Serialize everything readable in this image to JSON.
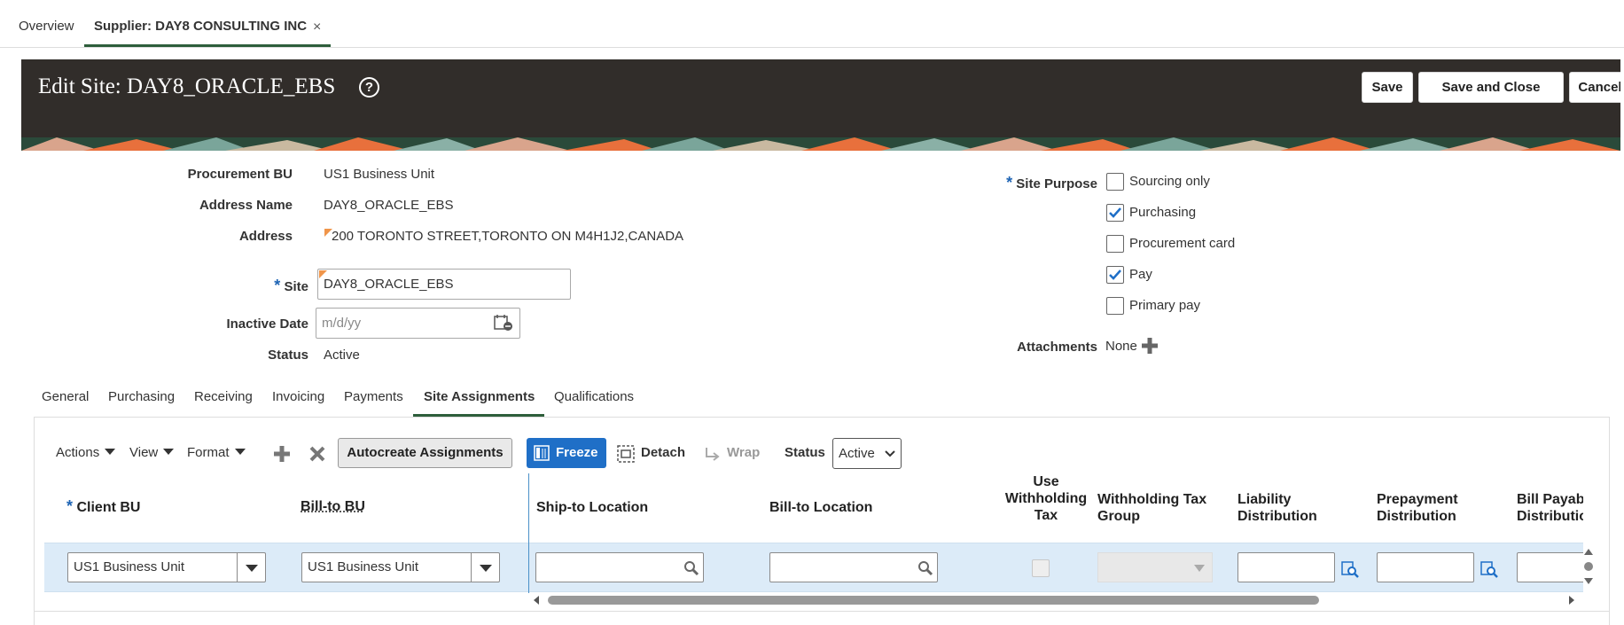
{
  "topnav": {
    "overview": "Overview",
    "supplier_tab": "Supplier: DAY8 CONSULTING INC",
    "close_glyph": "×"
  },
  "header": {
    "title": "Edit Site: DAY8_ORACLE_EBS",
    "help_glyph": "?",
    "save": "Save",
    "save_close": "Save and Close",
    "cancel": "Cancel"
  },
  "form": {
    "procurement_bu_label": "Procurement BU",
    "procurement_bu": "US1 Business Unit",
    "address_name_label": "Address Name",
    "address_name": "DAY8_ORACLE_EBS",
    "address_label": "Address",
    "address": "200 TORONTO STREET,TORONTO ON M4H1J2,CANADA",
    "site_label": "Site",
    "site": "DAY8_ORACLE_EBS",
    "inactive_date_label": "Inactive Date",
    "inactive_date_placeholder": "m/d/yy",
    "status_label": "Status",
    "status": "Active",
    "required_mark": "*"
  },
  "site_purpose": {
    "label": "Site Purpose",
    "options": [
      {
        "label": "Sourcing only",
        "checked": false
      },
      {
        "label": "Purchasing",
        "checked": true
      },
      {
        "label": "Procurement card",
        "checked": false
      },
      {
        "label": "Pay",
        "checked": true
      },
      {
        "label": "Primary pay",
        "checked": false
      }
    ],
    "attachments_label": "Attachments",
    "attachments_value": "None"
  },
  "tabs": [
    "General",
    "Purchasing",
    "Receiving",
    "Invoicing",
    "Payments",
    "Site Assignments",
    "Qualifications"
  ],
  "active_tab": "Site Assignments",
  "toolbar": {
    "actions": "Actions",
    "view": "View",
    "format": "Format",
    "autocreate": "Autocreate Assignments",
    "freeze": "Freeze",
    "detach": "Detach",
    "wrap": "Wrap",
    "status_label": "Status",
    "status_value": "Active"
  },
  "table": {
    "headers": {
      "client_bu": "Client BU",
      "bill_to_bu": "Bill-to BU",
      "ship_to": "Ship-to Location",
      "bill_to_loc": "Bill-to Location",
      "use_wht_1": "Use",
      "use_wht_2": "Withholding",
      "use_wht_3": "Tax",
      "wht_group_1": "Withholding Tax",
      "wht_group_2": "Group",
      "liability_1": "Liability",
      "liability_2": "Distribution",
      "prepay_1": "Prepayment",
      "prepay_2": "Distribution",
      "billpay_1": "Bill Payable",
      "billpay_2": "Distribution"
    },
    "rows": [
      {
        "client_bu": "US1 Business Unit",
        "bill_to_bu": "US1 Business Unit"
      }
    ]
  },
  "colors": {
    "header_bg": "#312d2a",
    "accent_blue": "#1f6fc7",
    "row_selected": "#dcebf8",
    "tab_underline": "#2e5e3b"
  }
}
